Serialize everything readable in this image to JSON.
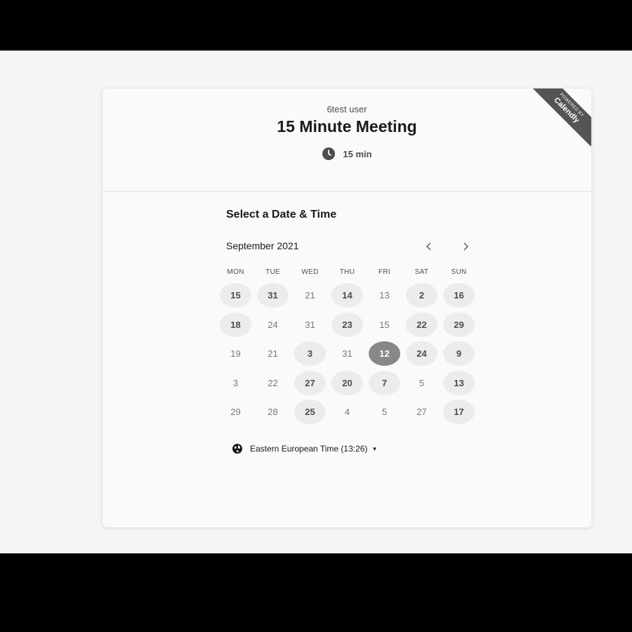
{
  "event": {
    "organizer": "6test user",
    "title": "15 Minute Meeting",
    "duration": "15 min"
  },
  "branding": {
    "powered_by": "POWERED BY",
    "brand": "Calendly"
  },
  "picker": {
    "title": "Select a Date & Time",
    "month": "September 2021",
    "prev_icon": "chevron-left-icon",
    "next_icon": "chevron-right-icon",
    "weekdays": [
      "MON",
      "TUE",
      "WED",
      "THU",
      "FRI",
      "SAT",
      "SUN"
    ],
    "weeks": [
      [
        {
          "d": "15",
          "s": "available"
        },
        {
          "d": "31",
          "s": "available"
        },
        {
          "d": "21",
          "s": "unavailable"
        },
        {
          "d": "14",
          "s": "available"
        },
        {
          "d": "13",
          "s": "unavailable"
        },
        {
          "d": "2",
          "s": "available"
        },
        {
          "d": "16",
          "s": "available"
        }
      ],
      [
        {
          "d": "18",
          "s": "available"
        },
        {
          "d": "24",
          "s": "unavailable"
        },
        {
          "d": "31",
          "s": "unavailable"
        },
        {
          "d": "23",
          "s": "available"
        },
        {
          "d": "15",
          "s": "unavailable"
        },
        {
          "d": "22",
          "s": "available"
        },
        {
          "d": "29",
          "s": "available"
        }
      ],
      [
        {
          "d": "19",
          "s": "unavailable"
        },
        {
          "d": "21",
          "s": "unavailable"
        },
        {
          "d": "3",
          "s": "available"
        },
        {
          "d": "31",
          "s": "unavailable"
        },
        {
          "d": "12",
          "s": "selected"
        },
        {
          "d": "24",
          "s": "available"
        },
        {
          "d": "9",
          "s": "available"
        }
      ],
      [
        {
          "d": "3",
          "s": "unavailable"
        },
        {
          "d": "22",
          "s": "unavailable"
        },
        {
          "d": "27",
          "s": "available"
        },
        {
          "d": "20",
          "s": "available"
        },
        {
          "d": "7",
          "s": "available"
        },
        {
          "d": "5",
          "s": "unavailable"
        },
        {
          "d": "13",
          "s": "available"
        }
      ],
      [
        {
          "d": "29",
          "s": "unavailable"
        },
        {
          "d": "28",
          "s": "unavailable"
        },
        {
          "d": "25",
          "s": "available"
        },
        {
          "d": "4",
          "s": "unavailable"
        },
        {
          "d": "5",
          "s": "unavailable"
        },
        {
          "d": "27",
          "s": "unavailable"
        },
        {
          "d": "17",
          "s": "available"
        }
      ]
    ]
  },
  "timezone": {
    "label": "Eastern European Time (13:26)",
    "icon": "globe-icon"
  },
  "colors": {
    "selected": "#888888",
    "available": "#ececec",
    "ribbon": "#555555"
  }
}
